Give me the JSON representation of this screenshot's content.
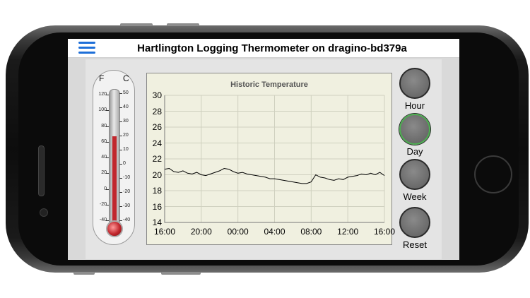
{
  "app": {
    "title": "Hartlington Logging Thermometer on dragino-bd379a"
  },
  "thermometer": {
    "fahrenheit_letter": "F",
    "celsius_letter": "C",
    "fahrenheit_scale": [
      "120",
      "100",
      "80",
      "60",
      "40",
      "20",
      "0",
      "-20",
      "-40"
    ],
    "celsius_scale": [
      "50",
      "40",
      "30",
      "20",
      "10",
      "0",
      "-10",
      "-20",
      "-30",
      "-40"
    ],
    "current_c": 20,
    "mercury_color": "#c1272d"
  },
  "buttons": [
    {
      "label": "Hour",
      "active": false
    },
    {
      "label": "Day",
      "active": true
    },
    {
      "label": "Week",
      "active": false
    },
    {
      "label": "Reset",
      "active": false
    }
  ],
  "chart_data": {
    "type": "line",
    "title": "Historic Temperature",
    "xlabel": "",
    "ylabel": "",
    "ylim": [
      14,
      30
    ],
    "y_ticks": [
      14,
      16,
      18,
      20,
      22,
      24,
      26,
      28,
      30
    ],
    "x_tick_labels": [
      "16:00",
      "20:00",
      "00:00",
      "04:00",
      "08:00",
      "12:00",
      "16:00"
    ],
    "x_range_hours": [
      0,
      24
    ],
    "grid": true,
    "line_color": "#000000",
    "series": [
      {
        "x": [
          0,
          0.5,
          1,
          1.5,
          2,
          2.5,
          3,
          3.5,
          4,
          4.5,
          5,
          5.5,
          6,
          6.5,
          7,
          7.5,
          8,
          8.5,
          9,
          9.5,
          10,
          10.5,
          11,
          11.5,
          12,
          12.5,
          13,
          13.5,
          14,
          14.5,
          15,
          15.5,
          16,
          16.5,
          17,
          17.5,
          18,
          18.5,
          19,
          19.5,
          20,
          20.5,
          21,
          21.5,
          22,
          22.5,
          23,
          23.5,
          24
        ],
        "y": [
          20.7,
          20.8,
          20.4,
          20.3,
          20.5,
          20.2,
          20.1,
          20.3,
          20.0,
          19.9,
          20.1,
          20.3,
          20.5,
          20.8,
          20.7,
          20.4,
          20.2,
          20.3,
          20.1,
          20.0,
          19.9,
          19.8,
          19.7,
          19.5,
          19.5,
          19.4,
          19.3,
          19.2,
          19.1,
          19.0,
          18.9,
          18.9,
          19.1,
          20.0,
          19.7,
          19.6,
          19.4,
          19.3,
          19.5,
          19.4,
          19.7,
          19.8,
          19.9,
          20.1,
          20.0,
          20.2,
          20.0,
          20.3,
          19.9
        ]
      }
    ]
  }
}
